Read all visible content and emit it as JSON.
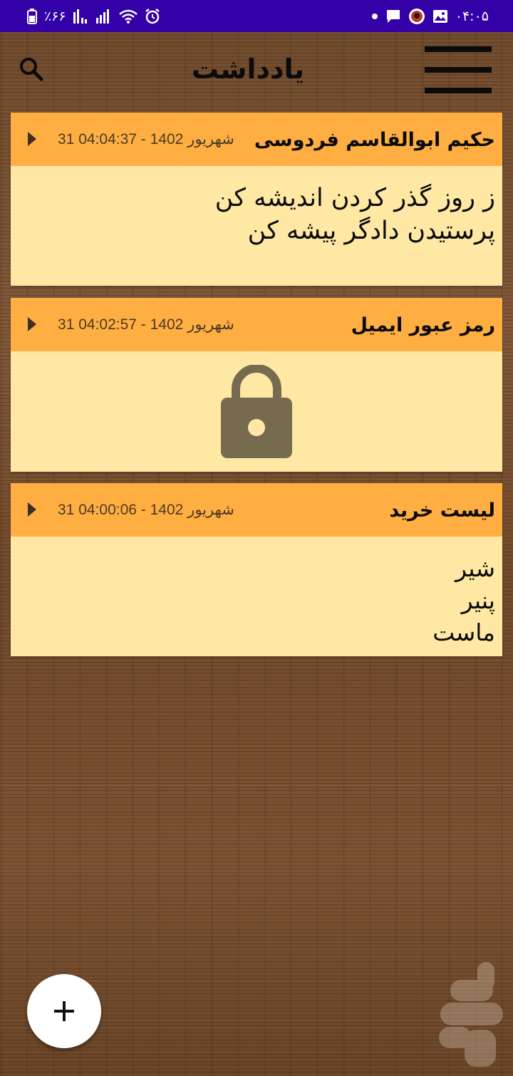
{
  "status_bar": {
    "time": "۰۴:۰۵",
    "battery": "٪۶۶"
  },
  "app_bar": {
    "title": "یادداشت"
  },
  "notes": [
    {
      "title": "حکیم ابوالقاسم فردوسی",
      "date": "31 شهریور 1402 - 04:04:37",
      "locked": false,
      "lines": [
        "ز روز گذر کردن اندیشه کن",
        "پرستیدن دادگر پیشه کن"
      ]
    },
    {
      "title": "رمز عبور ایمیل",
      "date": "31 شهریور 1402 - 04:02:57",
      "locked": true,
      "lines": []
    },
    {
      "title": "لیست خرید",
      "date": "31 شهریور 1402 - 04:00:06",
      "locked": false,
      "lines": [
        "شیر",
        "پنیر",
        "ماست"
      ]
    }
  ],
  "colors": {
    "status_bar": "#3400a8",
    "note_header": "#ffae42",
    "note_body": "#ffe8a4",
    "lock": "#776b4f",
    "fab": "#ffffff"
  },
  "icons": {
    "search": "search-icon",
    "menu": "hamburger-menu-icon",
    "expand": "play-arrow-icon",
    "lock": "lock-icon",
    "add": "plus-icon"
  }
}
